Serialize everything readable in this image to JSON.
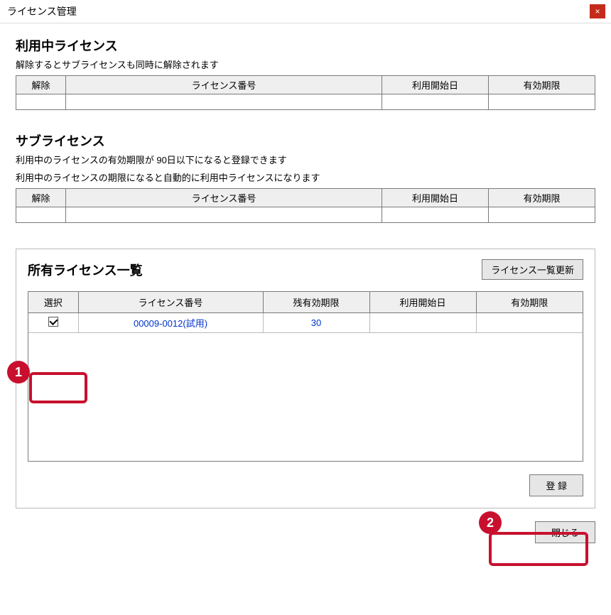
{
  "window": {
    "title": "ライセンス管理",
    "close_icon": "×"
  },
  "sections": {
    "active": {
      "title": "利用中ライセンス",
      "subtitle": "解除するとサブライセンスも同時に解除されます",
      "columns": {
        "release": "解除",
        "number": "ライセンス番号",
        "start": "利用開始日",
        "expiry": "有効期限"
      }
    },
    "sub": {
      "title": "サブライセンス",
      "subtitle1": "利用中のライセンスの有効期限が 90日以下になると登録できます",
      "subtitle2": "利用中のライセンスの期限になると自動的に利用中ライセンスになります",
      "columns": {
        "release": "解除",
        "number": "ライセンス番号",
        "start": "利用開始日",
        "expiry": "有効期限"
      }
    },
    "owned": {
      "title": "所有ライセンス一覧",
      "refresh_label": "ライセンス一覧更新",
      "columns": {
        "select": "選択",
        "number": "ライセンス番号",
        "remaining": "残有効期限",
        "start": "利用開始日",
        "expiry": "有効期限"
      },
      "rows": [
        {
          "selected": true,
          "number": "00009-0012(試用)",
          "remaining": "30",
          "start": "",
          "expiry": ""
        }
      ],
      "register_label": "登 録"
    }
  },
  "footer": {
    "close_label": "閉じる"
  },
  "annotations": {
    "badge1": "1",
    "badge2": "2"
  }
}
